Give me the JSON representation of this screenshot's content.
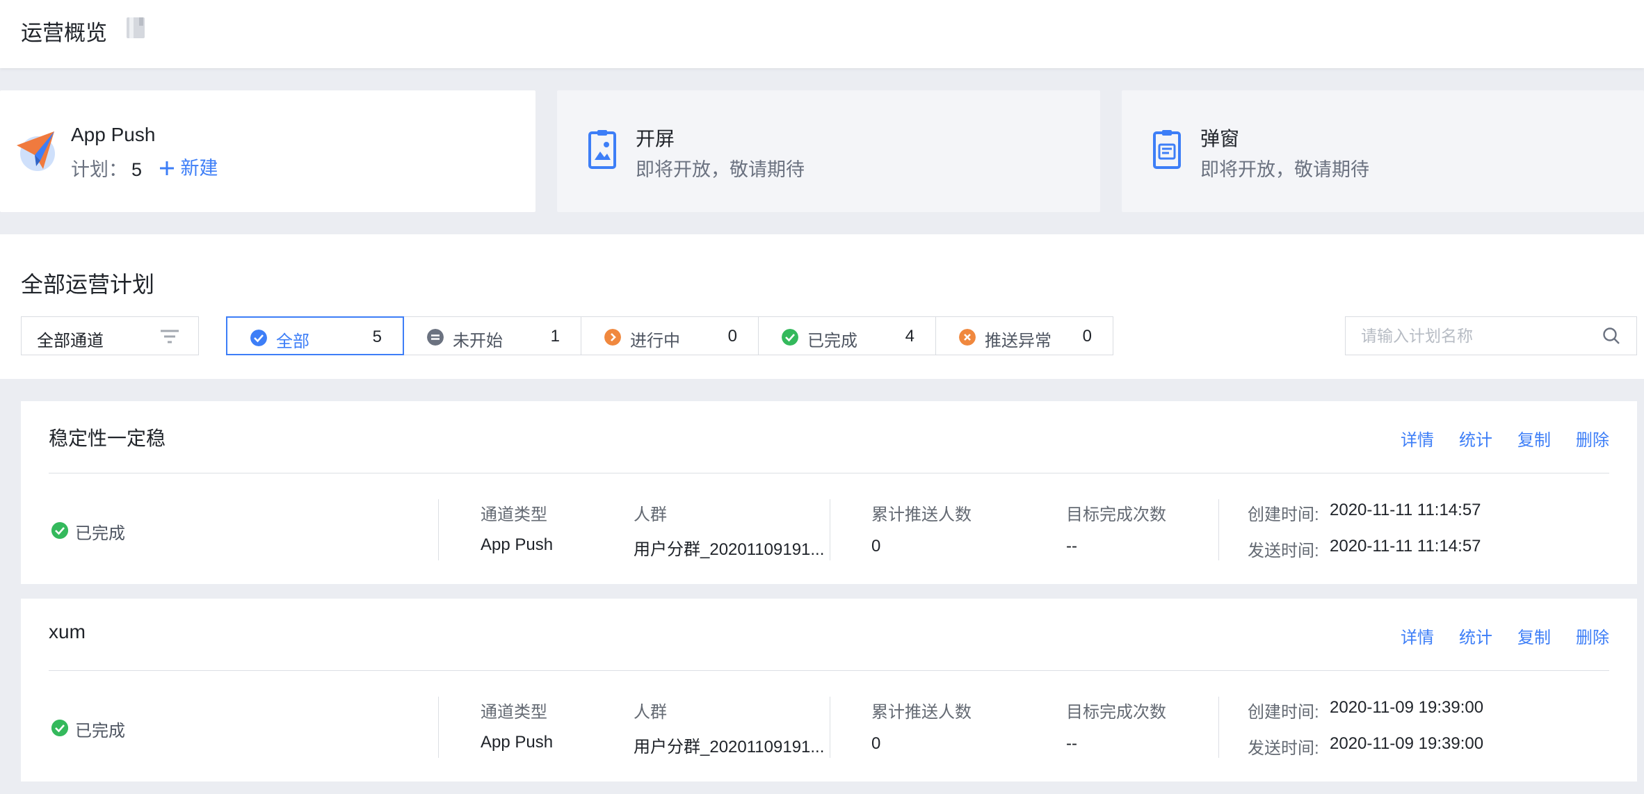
{
  "header": {
    "title": "运营概览",
    "doc_icon": "doc-icon"
  },
  "channels": [
    {
      "title": "App Push",
      "plan_label": "计划：",
      "plan_count": "5",
      "new_label": "新建",
      "icon": "paper-plane-icon"
    },
    {
      "title": "开屏",
      "subtitle": "即将开放，敬请期待",
      "icon": "splash-screen-icon"
    },
    {
      "title": "弹窗",
      "subtitle": "即将开放，敬请期待",
      "icon": "popup-icon"
    }
  ],
  "filter": {
    "section_title": "全部运营计划",
    "channel_select": "全部通道",
    "tabs": [
      {
        "label": "全部",
        "count": "5",
        "icon": "check-circle-icon",
        "color": "#3d7ef7",
        "active": true
      },
      {
        "label": "未开始",
        "count": "1",
        "icon": "pending-circle-icon",
        "color": "#6b7280",
        "active": false
      },
      {
        "label": "进行中",
        "count": "0",
        "icon": "running-circle-icon",
        "color": "#f0883e",
        "active": false
      },
      {
        "label": "已完成",
        "count": "4",
        "icon": "done-circle-icon",
        "color": "#34b95c",
        "active": false
      },
      {
        "label": "推送异常",
        "count": "0",
        "icon": "error-circle-icon",
        "color": "#f0883e",
        "active": false
      }
    ],
    "search_placeholder": "请输入计划名称"
  },
  "labels": {
    "channel_type": "通道类型",
    "audience": "人群",
    "total_push": "累计推送人数",
    "target_count": "目标完成次数",
    "created_at": "创建时间:",
    "sent_at": "发送时间:"
  },
  "actions": [
    "详情",
    "统计",
    "复制",
    "删除"
  ],
  "plans": [
    {
      "name": "稳定性一定稳",
      "status": "已完成",
      "channel_type": "App Push",
      "audience": "用户分群_20201109191...",
      "total_push": "0",
      "target_count": "--",
      "created_at": "2020-11-11 11:14:57",
      "sent_at": "2020-11-11 11:14:57"
    },
    {
      "name": "xum",
      "status": "已完成",
      "channel_type": "App Push",
      "audience": "用户分群_20201109191...",
      "total_push": "0",
      "target_count": "--",
      "created_at": "2020-11-09 19:39:00",
      "sent_at": "2020-11-09 19:39:00"
    }
  ]
}
